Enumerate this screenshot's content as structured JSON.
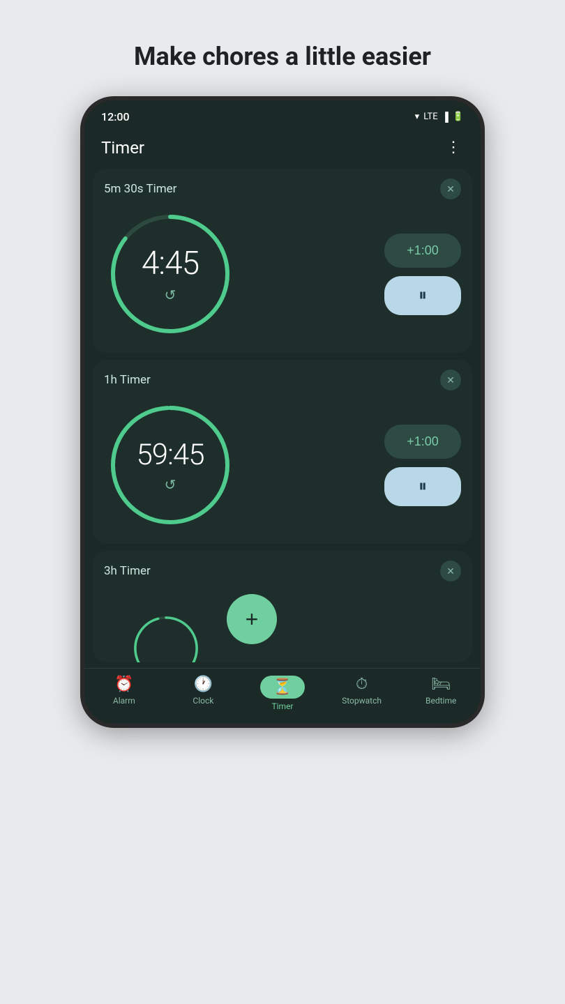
{
  "page": {
    "title": "Make chores a little easier"
  },
  "statusBar": {
    "time": "12:00",
    "signal": "LTE"
  },
  "appHeader": {
    "title": "Timer",
    "menuIcon": "⋮"
  },
  "timers": [
    {
      "id": "timer1",
      "label": "5m 30s Timer",
      "display": "4:45",
      "progress": 0.855,
      "addLabel": "+1:00",
      "pauseIcon": "⏸"
    },
    {
      "id": "timer2",
      "label": "1h Timer",
      "display": "59:45",
      "progress": 0.996,
      "addLabel": "+1:00",
      "pauseIcon": "⏸"
    },
    {
      "id": "timer3",
      "label": "3h Timer",
      "partial": true
    }
  ],
  "nav": {
    "items": [
      {
        "id": "alarm",
        "label": "Alarm",
        "icon": "⏰",
        "active": false
      },
      {
        "id": "clock",
        "label": "Clock",
        "icon": "🕐",
        "active": false
      },
      {
        "id": "timer",
        "label": "Timer",
        "icon": "⏳",
        "active": true
      },
      {
        "id": "stopwatch",
        "label": "Stopwatch",
        "icon": "⏱",
        "active": false
      },
      {
        "id": "bedtime",
        "label": "Bedtime",
        "icon": "🛏",
        "active": false
      }
    ]
  }
}
